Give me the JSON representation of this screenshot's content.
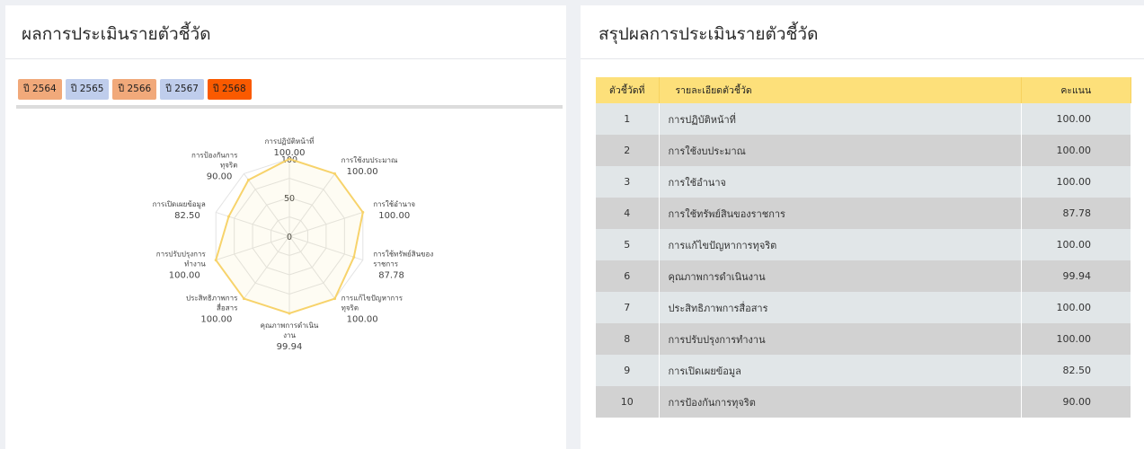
{
  "left_panel": {
    "title": "ผลการประเมินรายตัวชี้วัด",
    "years": [
      {
        "label": "ปี 2564",
        "color": "#f1a97a"
      },
      {
        "label": "ปี 2565",
        "color": "#bfcdec"
      },
      {
        "label": "ปี 2566",
        "color": "#f1a97a"
      },
      {
        "label": "ปี 2567",
        "color": "#bfcdec"
      },
      {
        "label": "ปี 2568",
        "color": "#fa5a00"
      }
    ],
    "selected_year": "ปี 2568"
  },
  "chart_data": {
    "type": "radar",
    "max": 100,
    "scale_labels": [
      "0",
      "50",
      "100"
    ],
    "series_color": "#f7d36b",
    "axes": [
      {
        "lines": [
          "การปฏิบัติหน้าที่"
        ],
        "value": 100,
        "value_label": "100.00"
      },
      {
        "lines": [
          "การใช้งบประมาณ"
        ],
        "value": 100,
        "value_label": "100.00"
      },
      {
        "lines": [
          "การใช้อำนาจ"
        ],
        "value": 100,
        "value_label": "100.00"
      },
      {
        "lines": [
          "การใช้ทรัพย์สินของ",
          "ราชการ"
        ],
        "value": 87.78,
        "value_label": "87.78"
      },
      {
        "lines": [
          "การแก้ไขปัญหาการ",
          "ทุจริต"
        ],
        "value": 100,
        "value_label": "100.00"
      },
      {
        "lines": [
          "คุณภาพการดำเนิน",
          "งาน"
        ],
        "value": 99.94,
        "value_label": "99.94"
      },
      {
        "lines": [
          "ประสิทธิภาพการ",
          "สื่อสาร"
        ],
        "value": 100,
        "value_label": "100.00"
      },
      {
        "lines": [
          "การปรับปรุงการ",
          "ทำงาน"
        ],
        "value": 100,
        "value_label": "100.00"
      },
      {
        "lines": [
          "การเปิดเผยข้อมูล"
        ],
        "value": 82.5,
        "value_label": "82.50"
      },
      {
        "lines": [
          "การป้องกันการ",
          "ทุจริต"
        ],
        "value": 90,
        "value_label": "90.00"
      }
    ]
  },
  "right_panel": {
    "title": "สรุปผลการประเมินรายตัวชี้วัด",
    "headers": {
      "no": "ตัวชี้วัดที่",
      "desc": "รายละเอียดตัวชี้วัด",
      "score": "คะแนน"
    },
    "header_color": "#fde07a",
    "rows": [
      {
        "no": "1",
        "desc": "การปฏิบัติหน้าที่",
        "score": "100.00"
      },
      {
        "no": "2",
        "desc": "การใช้งบประมาณ",
        "score": "100.00"
      },
      {
        "no": "3",
        "desc": "การใช้อำนาจ",
        "score": "100.00"
      },
      {
        "no": "4",
        "desc": "การใช้ทรัพย์สินของราชการ",
        "score": "87.78"
      },
      {
        "no": "5",
        "desc": "การแก้ไขปัญหาการทุจริต",
        "score": "100.00"
      },
      {
        "no": "6",
        "desc": "คุณภาพการดำเนินงาน",
        "score": "99.94"
      },
      {
        "no": "7",
        "desc": "ประสิทธิภาพการสื่อสาร",
        "score": "100.00"
      },
      {
        "no": "8",
        "desc": "การปรับปรุงการทำงาน",
        "score": "100.00"
      },
      {
        "no": "9",
        "desc": "การเปิดเผยข้อมูล",
        "score": "82.50"
      },
      {
        "no": "10",
        "desc": "การป้องกันการทุจริต",
        "score": "90.00"
      }
    ]
  }
}
